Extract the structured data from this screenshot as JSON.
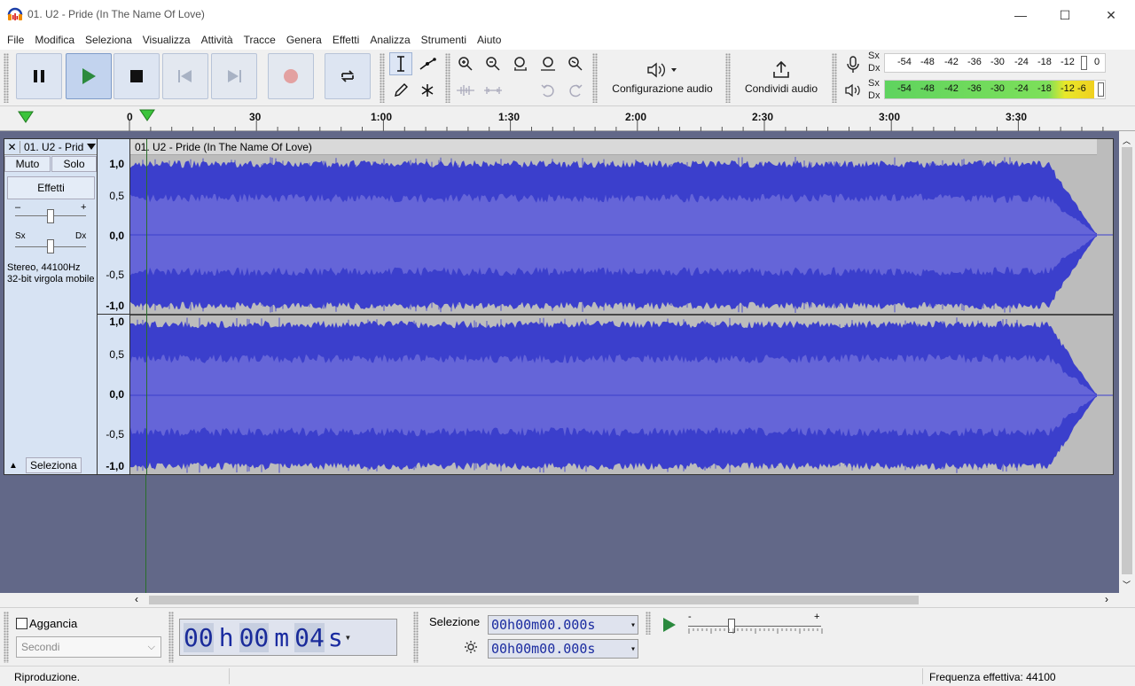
{
  "window": {
    "title": "01. U2 - Pride (In The Name Of Love)",
    "minimize": "—",
    "maximize": "☐",
    "close": "✕"
  },
  "menu": [
    "File",
    "Modifica",
    "Seleziona",
    "Visualizza",
    "Attività",
    "Tracce",
    "Genera",
    "Effetti",
    "Analizza",
    "Strumenti",
    "Aiuto"
  ],
  "toolbar": {
    "audio_setup_label": "Configurazione audio",
    "share_audio_label": "Condividi audio"
  },
  "meters": {
    "rec_sx": "Sx",
    "rec_dx": "Dx",
    "play_sx": "Sx",
    "play_dx": "Dx",
    "rec_scale": [
      "-54",
      "-48",
      "-42",
      "-36",
      "-30",
      "-24",
      "-18",
      "-12",
      "0"
    ],
    "play_scale": [
      "-54",
      "-48",
      "-42",
      "-36",
      "-30",
      "-24",
      "-18",
      "-12",
      "-6"
    ],
    "play_level": 0.95
  },
  "ruler": {
    "ticks": [
      "0",
      "30",
      "1:00",
      "1:30",
      "2:00",
      "2:30",
      "3:00",
      "3:30"
    ]
  },
  "track": {
    "name": "01. U2 - Prid",
    "clip_title": "01. U2 - Pride (In The Name Of Love)",
    "mute": "Muto",
    "solo": "Solo",
    "effects": "Effetti",
    "gain_minus": "–",
    "gain_plus": "+",
    "pan_left": "Sx",
    "pan_right": "Dx",
    "info_line1": "Stereo, 44100Hz",
    "info_line2": "32-bit virgola mobile",
    "select": "Seleziona",
    "scale": [
      "1,0",
      "0,5",
      "0,0",
      "-0,5",
      "-1,0"
    ]
  },
  "bottom": {
    "snap_label": "Aggancia",
    "snap_unit": "Secondi",
    "time_hours": "00",
    "time_h": "h",
    "time_minutes": "00",
    "time_m": "m",
    "time_seconds": "04",
    "time_s": "s",
    "selection_label": "Selezione",
    "sel_start": "00h00m00.000s",
    "sel_end": "00h00m00.000s"
  },
  "status": {
    "left": "Riproduzione.",
    "right": "Frequenza effettiva: 44100"
  },
  "colors": {
    "wave_dark": "#3b3fcc",
    "wave_light": "#6565d8",
    "wave_bg": "#bcbcbc",
    "track_bg": "#626888",
    "panel": "#d7e3f3",
    "time_digits": "#1a2ba0"
  }
}
